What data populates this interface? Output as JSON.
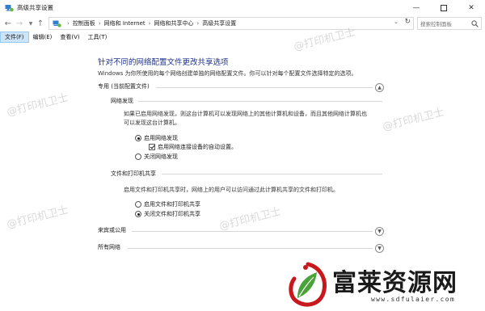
{
  "window": {
    "title": "高级共享设置",
    "icons": {
      "app": "network-settings-icon",
      "minimize": "minimize-icon",
      "maximize": "maximize-icon",
      "close": "close-icon"
    }
  },
  "address_bar": {
    "breadcrumbs": [
      "控制面板",
      "网络和 Internet",
      "网络和共享中心",
      "高级共享设置"
    ],
    "search_placeholder": "搜索控制面板"
  },
  "menu": {
    "items": [
      "文件(F)",
      "编辑(E)",
      "查看(V)",
      "工具(T)"
    ],
    "active_index": 0
  },
  "main": {
    "title": "针对不同的网络配置文件更改共享选项",
    "description": "Windows 为你所使用的每个网络创建单独的网络配置文件。你可以针对每个配置文件选择特定的选项。",
    "profiles": [
      {
        "label": "专用 (当前配置文件)",
        "expanded": true
      },
      {
        "label": "来宾或公用",
        "expanded": false
      },
      {
        "label": "所有网络",
        "expanded": false
      }
    ],
    "network_discovery": {
      "heading": "网络发现",
      "description_line1": "如果已启用网络发现，则这台计算机可以发现网络上的其他计算机和设备，而且其他网络计算机也",
      "description_line2": "可以发现这台计算机。",
      "option_on": "启用网络发现",
      "option_on_selected": true,
      "auto_setup": "启用网络连接设备的自动设置。",
      "auto_setup_checked": true,
      "option_off": "关闭网络发现"
    },
    "file_printer_sharing": {
      "heading": "文件和打印机共享",
      "description": "启用文件和打印机共享时，网络上的用户可以访问通过此计算机共享的文件和打印机。",
      "option_on": "启用文件和打印机共享",
      "option_off": "关闭文件和打印机共享",
      "option_off_selected": true
    }
  },
  "watermarks": [
    "@打印机卫士",
    "@打印机卫士",
    "@打印机卫士",
    "@打印机卫士",
    "@打印机卫士"
  ],
  "brand": {
    "name": "富莱资源网",
    "url": "www.sdfulaier.com",
    "icon": "leaf-logo-icon"
  },
  "colors": {
    "title_blue": "#1e3287",
    "menu_active": "#cce4f7",
    "brand_red": "#c8171d",
    "brand_green": "#4aa339"
  }
}
